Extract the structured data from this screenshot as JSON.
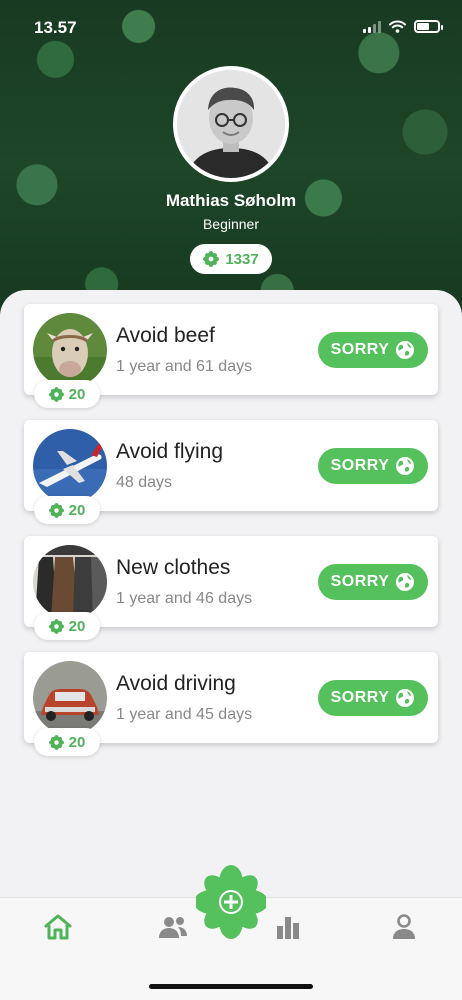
{
  "status_bar": {
    "time": "13.57"
  },
  "profile": {
    "name": "Mathias Søholm",
    "level": "Beginner",
    "points": "1337"
  },
  "sorry_label": "SORRY",
  "actions": [
    {
      "title": "Avoid beef",
      "duration": "1 year and 61 days",
      "points": "20",
      "image": "cow-photo"
    },
    {
      "title": "Avoid flying",
      "duration": "48 days",
      "points": "20",
      "image": "airplane-photo"
    },
    {
      "title": "New clothes",
      "duration": "1 year and 46 days",
      "points": "20",
      "image": "clothes-photo"
    },
    {
      "title": "Avoid driving",
      "duration": "1 year and 45 days",
      "points": "20",
      "image": "car-photo"
    }
  ],
  "colors": {
    "accent": "#54c15d",
    "accent_text": "#4fb35a"
  },
  "tabbar": {
    "tabs": [
      {
        "icon": "home-icon",
        "active": true
      },
      {
        "icon": "people-icon",
        "active": false
      },
      {
        "icon": "add-flower-icon",
        "active": false
      },
      {
        "icon": "stats-icon",
        "active": false
      },
      {
        "icon": "profile-icon",
        "active": false
      }
    ]
  }
}
